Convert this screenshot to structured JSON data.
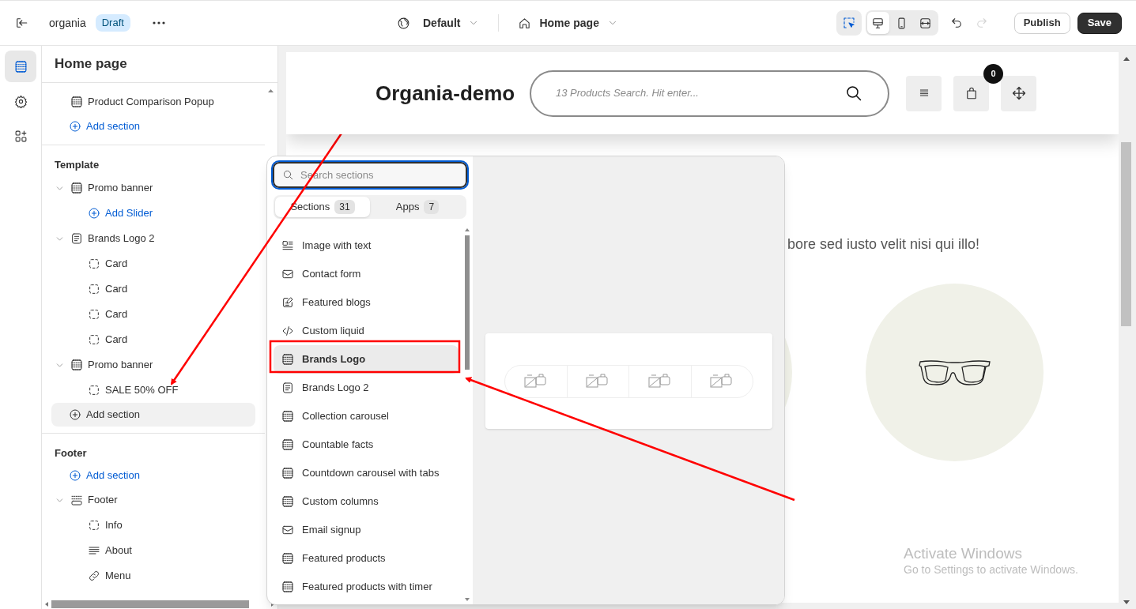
{
  "topbar": {
    "store_name": "organia",
    "status": "Draft",
    "theme": "Default",
    "page": "Home page",
    "inspector": {
      "on": true
    },
    "view_modes": [
      {
        "kind": "desktop",
        "selected": true
      },
      {
        "kind": "mobile",
        "selected": false
      },
      {
        "kind": "fullwidth",
        "selected": false
      }
    ],
    "redo_disabled": true,
    "buttons": [
      {
        "label": "Publish",
        "kind": "secondary"
      },
      {
        "label": "Save",
        "kind": "primary"
      }
    ]
  },
  "rail": [
    {
      "kind": "sections",
      "selected": true
    },
    {
      "kind": "settings",
      "selected": false
    },
    {
      "kind": "apps",
      "selected": false
    }
  ],
  "sidebar": {
    "title": "Home page",
    "groups": [
      {
        "items": [
          {
            "label": "Product Comparison Popup",
            "kind": "section"
          },
          {
            "label": "Add section",
            "kind": "add_section",
            "highlighted": false
          }
        ]
      },
      {
        "title": "Template",
        "items": [
          {
            "label": "Promo banner",
            "kind": "section",
            "expanded": true,
            "children": [
              {
                "label": "Add Slider",
                "kind": "add"
              }
            ]
          },
          {
            "label": "Brands Logo 2",
            "kind": "doc",
            "expanded": true,
            "children": [
              {
                "label": "Card",
                "kind": "block"
              },
              {
                "label": "Card",
                "kind": "block"
              },
              {
                "label": "Card",
                "kind": "block"
              },
              {
                "label": "Card",
                "kind": "block"
              }
            ]
          },
          {
            "label": "Promo banner",
            "kind": "section",
            "expanded": true,
            "children": [
              {
                "label": "SALE 50% OFF",
                "kind": "block"
              }
            ]
          },
          {
            "label": "Add section",
            "kind": "add_section",
            "highlighted": true
          }
        ]
      },
      {
        "title": "Footer",
        "items": [
          {
            "label": "Add section",
            "kind": "add_section",
            "highlighted": false
          },
          {
            "label": "Footer",
            "kind": "footer",
            "expanded": true,
            "children": [
              {
                "label": "Info",
                "kind": "block"
              },
              {
                "label": "About",
                "kind": "text"
              },
              {
                "label": "Menu",
                "kind": "link"
              }
            ]
          }
        ]
      }
    ]
  },
  "popup": {
    "search": {
      "placeholder": "Search sections",
      "focused": true
    },
    "tabs": [
      {
        "label": "Sections",
        "count": "31",
        "selected": true
      },
      {
        "label": "Apps",
        "count": "7",
        "selected": false
      }
    ],
    "items": [
      {
        "label": "Image with text",
        "kind": "imagetext",
        "selected": false
      },
      {
        "label": "Contact form",
        "kind": "mail",
        "selected": false
      },
      {
        "label": "Featured blogs",
        "kind": "edit",
        "selected": false
      },
      {
        "label": "Custom liquid",
        "kind": "code",
        "selected": false
      },
      {
        "label": "Brands Logo",
        "kind": "section",
        "selected": true
      },
      {
        "label": "Brands Logo 2",
        "kind": "doc",
        "selected": false
      },
      {
        "label": "Collection carousel",
        "kind": "section",
        "selected": false
      },
      {
        "label": "Countable facts",
        "kind": "section",
        "selected": false
      },
      {
        "label": "Countdown carousel with tabs",
        "kind": "section",
        "selected": false
      },
      {
        "label": "Custom columns",
        "kind": "section",
        "selected": false
      },
      {
        "label": "Email signup",
        "kind": "mail",
        "selected": false
      },
      {
        "label": "Featured products",
        "kind": "section",
        "selected": false
      },
      {
        "label": "Featured products with timer",
        "kind": "section",
        "selected": false
      }
    ]
  },
  "preview": {
    "logo": "Organia-demo",
    "search_placeholder": "13 Products Search. Hit enter...",
    "cart_count": "0",
    "body_text": "bore sed iusto velit nisi qui illo!"
  },
  "watermark": {
    "title": "Activate Windows",
    "subtitle": "Go to Settings to activate Windows."
  }
}
